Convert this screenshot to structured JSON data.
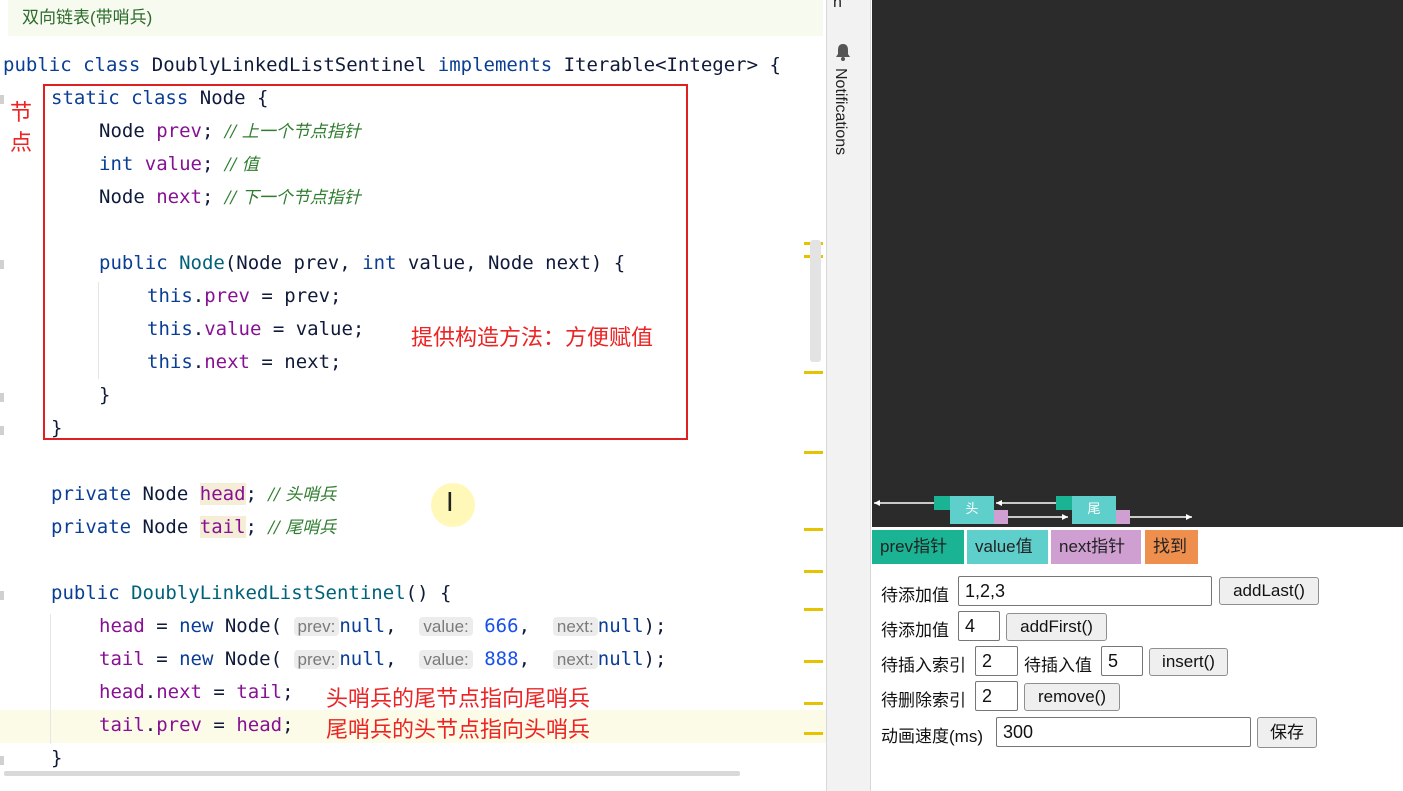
{
  "editor": {
    "doc_comment": "双向链表(带哨兵)",
    "code": {
      "l1_public": "public",
      "l1_class": "class",
      "l1_name": "DoublyLinkedListSentinel",
      "l1_implements": "implements",
      "l1_rest": "Iterable<Integer> {",
      "l2_static": "static",
      "l2_class": "class",
      "l2_rest": "Node {",
      "l3_type": "Node",
      "l3_field": "prev",
      "l3_comment": "// 上一个节点指针",
      "l4_type": "int",
      "l4_field": "value",
      "l4_comment": "// 值",
      "l5_type": "Node",
      "l5_field": "next",
      "l5_comment": "// 下一个节点指针",
      "l6_public": "public",
      "l6_ctor": "Node",
      "l6_p1": "(Node prev, ",
      "l6_int": "int",
      "l6_p2": " value, Node next) {",
      "l7_this": "this",
      "l7_field": "prev",
      "l7_rest": " = prev;",
      "l8_this": "this",
      "l8_field": "value",
      "l8_rest": " = value;",
      "l9_this": "this",
      "l9_field": "next",
      "l9_rest": " = next;",
      "l10": "}",
      "l11": "}",
      "l12_private": "private",
      "l12_type": "Node",
      "l12_field": "head",
      "l12_comment": "// 头哨兵",
      "l13_private": "private",
      "l13_type": "Node",
      "l13_field": "tail",
      "l13_comment": "// 尾哨兵",
      "l14_public": "public",
      "l14_ctor": "DoublyLinkedListSentinel",
      "l14_rest": "() {",
      "l15_field": "head",
      "l15_eq": " = ",
      "l15_new": "new",
      "l15_node": " Node(",
      "l15_hint1": "prev:",
      "l15_v1": "null",
      "l15_hint2": "value:",
      "l15_v2": "666",
      "l15_hint3": "next:",
      "l15_v3": "null",
      "l15_end": ");",
      "l16_field": "tail",
      "l16_eq": " = ",
      "l16_new": "new",
      "l16_node": " Node(",
      "l16_hint1": "prev:",
      "l16_v1": "null",
      "l16_hint2": "value:",
      "l16_v2": "888",
      "l16_hint3": "next:",
      "l16_v3": "null",
      "l16_end": ");",
      "l17_head": "head",
      "l17_field": "next",
      "l17_eq": " = ",
      "l17_tail": "tail",
      "l17_end": ";",
      "l18_tail": "tail",
      "l18_field": "prev",
      "l18_eq": " = ",
      "l18_head": "head",
      "l18_end": ";",
      "l19": "}"
    },
    "annotations": {
      "node_label": "节\n点",
      "ctor_note": "提供构造方法：方便赋值",
      "head_note": "头哨兵的尾节点指向尾哨兵",
      "tail_note": "尾哨兵的头节点指向头哨兵"
    }
  },
  "sidebar": {
    "top_label": "n",
    "notifications_label": "Notifications"
  },
  "visualizer": {
    "head_node_label": "头",
    "tail_node_label": "尾",
    "legend": [
      {
        "label": "prev指针",
        "color": "#1ab394"
      },
      {
        "label": "value值",
        "color": "#5ecfcb"
      },
      {
        "label": "next指针",
        "color": "#cf9fd1"
      },
      {
        "label": "找到",
        "color": "#ef8f4e"
      }
    ],
    "form": {
      "add_last_label": "待添加值",
      "add_last_value": "1,2,3",
      "add_last_button": "addLast()",
      "add_first_label": "待添加值",
      "add_first_value": "4",
      "add_first_button": "addFirst()",
      "insert_index_label": "待插入索引",
      "insert_index_value": "2",
      "insert_value_label": "待插入值",
      "insert_value_value": "5",
      "insert_button": "insert()",
      "remove_index_label": "待删除索引",
      "remove_index_value": "2",
      "remove_button": "remove()",
      "speed_label": "动画速度(ms)",
      "speed_value": "300",
      "save_button": "保存"
    }
  }
}
